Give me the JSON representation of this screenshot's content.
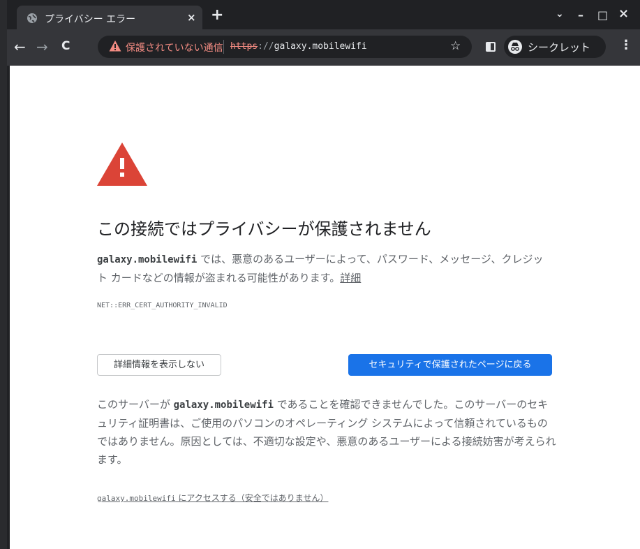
{
  "window": {
    "controls": {
      "minimize": "–",
      "maximize": "□",
      "close": "×",
      "dropdown": "⌄"
    }
  },
  "tab": {
    "title": "プライバシー エラー",
    "close": "×",
    "favicon": "globe-icon"
  },
  "new_tab": "+",
  "toolbar": {
    "back": "←",
    "forward": "→",
    "reload": "C",
    "not_secure_label": "保護されていない通信",
    "url_scheme": "https",
    "url_sep": "://",
    "url_host": "galaxy.mobilewifi",
    "bookmark": "☆",
    "incognito_label": "シークレット",
    "menu": "⋮"
  },
  "page": {
    "heading": "この接続ではプライバシーが保護されません",
    "para1_host": "galaxy.mobilewifi",
    "para1_text": " では、悪意のあるユーザーによって、パスワード、メッセージ、クレジット カードなどの情報が盗まれる可能性があります。",
    "details_link": "詳細",
    "error_code": "NET::ERR_CERT_AUTHORITY_INVALID",
    "hide_details_button": "詳細情報を表示しない",
    "back_to_safety_button": "セキュリティで保護されたページに戻る",
    "para2_prefix": "このサーバーが ",
    "para2_host": "galaxy.mobilewifi",
    "para2_text": " であることを確認できませんでした。このサーバーのセキュリティ証明書は、ご使用のパソコンのオペレーティング システムによって信頼されているものではありません。原因としては、不適切な設定や、悪意のあるユーザーによる接続妨害が考えられます。",
    "proceed_host": "galaxy.mobilewifi",
    "proceed_text": " にアクセスする（安全ではありません）"
  },
  "colors": {
    "warning_red": "#db4437",
    "primary_blue": "#1a73e8",
    "not_secure_text": "#f28b82"
  }
}
